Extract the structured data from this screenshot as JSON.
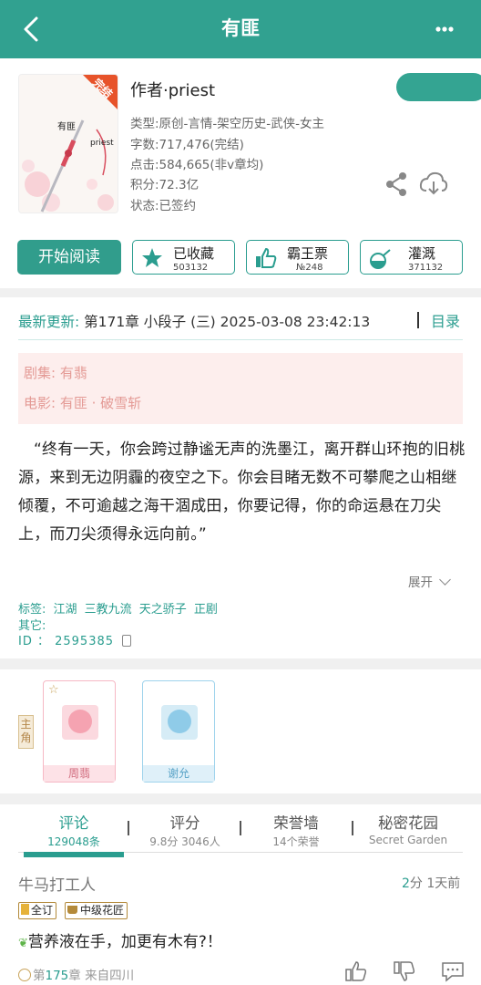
{
  "header": {
    "title": "有匪"
  },
  "book": {
    "cover_title": "有匪",
    "cover_author": "priest",
    "cover_badge": "完结",
    "author": "作者·priest",
    "type": "类型:原创-言情-架空历史-武侠-女主",
    "words": "字数:717,476(完结)",
    "clicks": "点击:584,665(非v章均)",
    "points": "积分:72.3亿",
    "status": "状态:已签约"
  },
  "actions": {
    "read": "开始阅读",
    "collect": {
      "label": "已收藏",
      "count": "503132"
    },
    "ticket": {
      "label": "霸王票",
      "count": "№248"
    },
    "water": {
      "label": "灌溉",
      "count": "371132"
    }
  },
  "latest": {
    "prefix": "最新更新:",
    "value": "第171章 小段子 (三) 2025-03-08 23:42:13",
    "dir": "目录"
  },
  "adaptations": {
    "drama": "剧集: 有翡",
    "movie": "电影: 有匪 · 破雪斩"
  },
  "intro": "“终有一天，你会跨过静谧无声的洗墨江，离开群山环抱的旧桃源，来到无边阴霾的夜空之下。你会目睹无数不可攀爬之山相继倾覆，不可逾越之海干涸成田，你要记得，你的命运悬在刀尖上，而刀尖须得永远向前。”",
  "expand": "展开",
  "tags": "标签: 江湖 三教九流 天之骄子 正剧",
  "others": "其它:",
  "id_line": "ID ： 2595385",
  "roles": {
    "badge": "主角",
    "items": [
      {
        "name": "周翡",
        "color": "#f6b8c4"
      },
      {
        "name": "谢允",
        "color": "#9ed3ec"
      }
    ]
  },
  "tabs": [
    {
      "label": "评论",
      "sub": "129048条"
    },
    {
      "label": "评分",
      "sub": "9.8分 3046人"
    },
    {
      "label": "荣誉墙",
      "sub": "14个荣誉"
    },
    {
      "label": "秘密花园",
      "sub": "Secret Garden"
    }
  ],
  "comment": {
    "user": "牛马打工人",
    "score": "2",
    "score_rest": "分 1天前",
    "badges": [
      "全订",
      "中级花匠"
    ],
    "text": "营养液在手，加更有木有?！",
    "foot_pre": "第",
    "foot_num": "175",
    "foot_post": "章 来自四川"
  },
  "colors": {
    "accent": "#2a9d8f",
    "header": "#31a190"
  }
}
